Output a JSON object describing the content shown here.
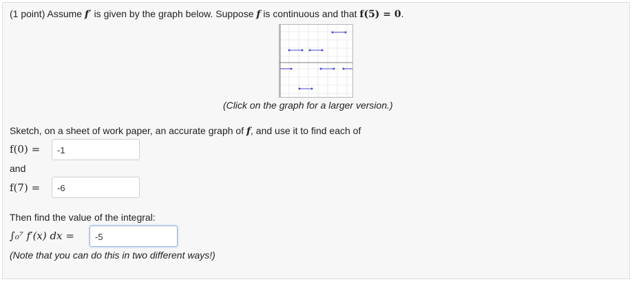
{
  "problem": {
    "intro_prefix": "(1 point) Assume",
    "fprime": "f′",
    "intro_mid1": "is given by the graph below. Suppose",
    "f": "f",
    "intro_mid2": "is continuous and that",
    "condition": "f(5) = 0",
    "intro_end": ".",
    "caption": "(Click on the graph for a larger version.)",
    "sketch_text": "Sketch, on a sheet of work paper, an accurate graph of",
    "sketch_f": "f",
    "sketch_end": ", and use it to find each of",
    "q1_label": "f(0) =",
    "q1_value": "-1",
    "and_text": "and",
    "q2_label": "f(7) =",
    "q2_value": "-6",
    "integral_intro": "Then find the value of the integral:",
    "integral_label": "∫₀⁷ f′(x) dx =",
    "integral_value": "-5",
    "note": "(Note that you can do this in two different ways!)"
  },
  "colors": {
    "segment": "#4a4ad0",
    "grid": "#d8d8d8",
    "axis": "#555555",
    "focus": "#8fb4e6"
  }
}
